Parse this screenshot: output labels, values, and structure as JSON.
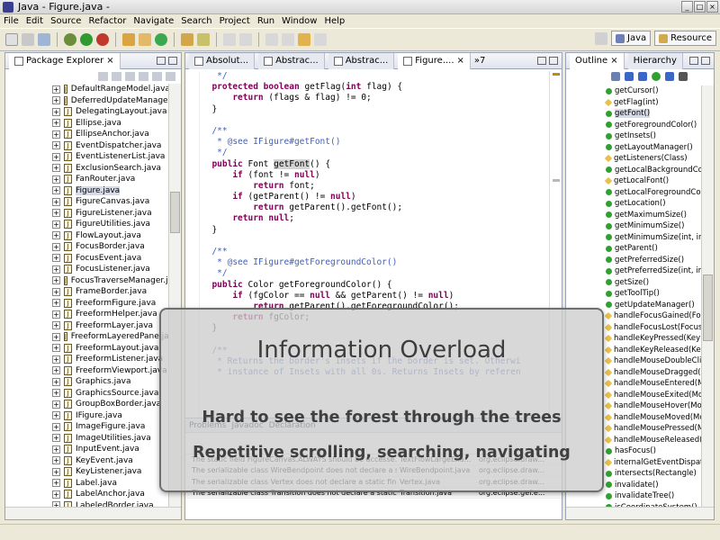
{
  "window": {
    "title": "Java - Figure.java -"
  },
  "menu": [
    "File",
    "Edit",
    "Source",
    "Refactor",
    "Navigate",
    "Search",
    "Project",
    "Run",
    "Window",
    "Help"
  ],
  "perspectives": {
    "java": "Java",
    "resource": "Resource"
  },
  "package_explorer": {
    "title": "Package Explorer",
    "items": [
      "DefaultRangeModel.java",
      "DeferredUpdateManager.ja",
      "DelegatingLayout.java",
      "Ellipse.java",
      "EllipseAnchor.java",
      "EventDispatcher.java",
      "EventListenerList.java",
      "ExclusionSearch.java",
      "FanRouter.java",
      "Figure.java",
      "FigureCanvas.java",
      "FigureListener.java",
      "FigureUtilities.java",
      "FlowLayout.java",
      "FocusBorder.java",
      "FocusEvent.java",
      "FocusListener.java",
      "FocusTraverseManager.jav",
      "FrameBorder.java",
      "FreeformFigure.java",
      "FreeformHelper.java",
      "FreeformLayer.java",
      "FreeformLayeredPane.java",
      "FreeformLayout.java",
      "FreeformListener.java",
      "FreeformViewport.java",
      "Graphics.java",
      "GraphicsSource.java",
      "GroupBoxBorder.java",
      "IFigure.java",
      "ImageFigure.java",
      "ImageUtilities.java",
      "InputEvent.java",
      "KeyEvent.java",
      "KeyListener.java",
      "Label.java",
      "LabelAnchor.java",
      "LabeledBorder.java"
    ],
    "selected": "Figure.java"
  },
  "editor": {
    "tabs": [
      "Absolut...",
      "Abstrac...",
      "Abstrac...",
      "Figure...."
    ],
    "overflow": "»7",
    "lines": [
      "   */",
      "  protected boolean getFlag(int flag) {",
      "      return (flags & flag) != 0;",
      "  }",
      "",
      "  /**",
      "   * @see IFigure#getFont()",
      "   */",
      "  public Font getFont() {",
      "      if (font != null)",
      "          return font;",
      "      if (getParent() != null)",
      "          return getParent().getFont();",
      "      return null;",
      "  }",
      "",
      "  /**",
      "   * @see IFigure#getForegroundColor()",
      "   */",
      "  public Color getForegroundColor() {",
      "      if (fgColor == null && getParent() != null)",
      "          return getParent().getForegroundColor();",
      "      return fgColor;",
      "  }",
      "",
      "  /**",
      "   * Returns the border's Insets if the border is set. Otherwi",
      "   * instance of Insets with all 0s. Returns Insets by referen"
    ]
  },
  "problems": {
    "tabs": [
      "Problems",
      "Javadoc",
      "Declaration"
    ],
    "rows": [
      [
        "The static field FigureCanvas.ALWAYS should be accesse...",
        "TextFlowLargeExa...",
        "org.eclipse.draw..."
      ],
      [
        "The serializable class WireBendpoint does not declare a s...",
        "WireBendpoint.java",
        "org.eclipse.draw..."
      ],
      [
        "The serializable class Vertex does not declare a static fin...",
        "Vertex.java",
        "org.eclipse.draw..."
      ],
      [
        "The serializable class Transition does not declare a static ...",
        "Transition.java",
        "org.eclipse.gef.e..."
      ]
    ]
  },
  "outline": {
    "tabs": [
      "Outline",
      "Hierarchy"
    ],
    "items": [
      "getCursor()",
      "getFlag(int)",
      "getFont()",
      "getForegroundColor()",
      "getInsets()",
      "getLayoutManager()",
      "getListeners(Class)",
      "getLocalBackgroundColo",
      "getLocalFont()",
      "getLocalForegroundColo",
      "getLocation()",
      "getMaximumSize()",
      "getMinimumSize()",
      "getMinimumSize(int, int)",
      "getParent()",
      "getPreferredSize()",
      "getPreferredSize(int, int",
      "getSize()",
      "getToolTip()",
      "getUpdateManager()",
      "handleFocusGained(Foc",
      "handleFocusLost(FocusE",
      "handleKeyPressed(KeyE",
      "handleKeyReleased(Key",
      "handleMouseDoubleClick",
      "handleMouseDragged(M",
      "handleMouseEntered(M",
      "handleMouseExited(Mou",
      "handleMouseHover(Mou",
      "handleMouseMoved(Mo",
      "handleMousePressed(M",
      "handleMouseReleased(M",
      "hasFocus()",
      "internalGetEventDispatc",
      "intersects(Rectangle)",
      "invalidate()",
      "invalidateTree()",
      "isCoordinateSystem()"
    ],
    "selected": "getFont()"
  },
  "overlay": {
    "title": "Information Overload",
    "line1": "Hard to see the forest through the trees",
    "line2": "Repetitive scrolling, searching, navigating"
  }
}
